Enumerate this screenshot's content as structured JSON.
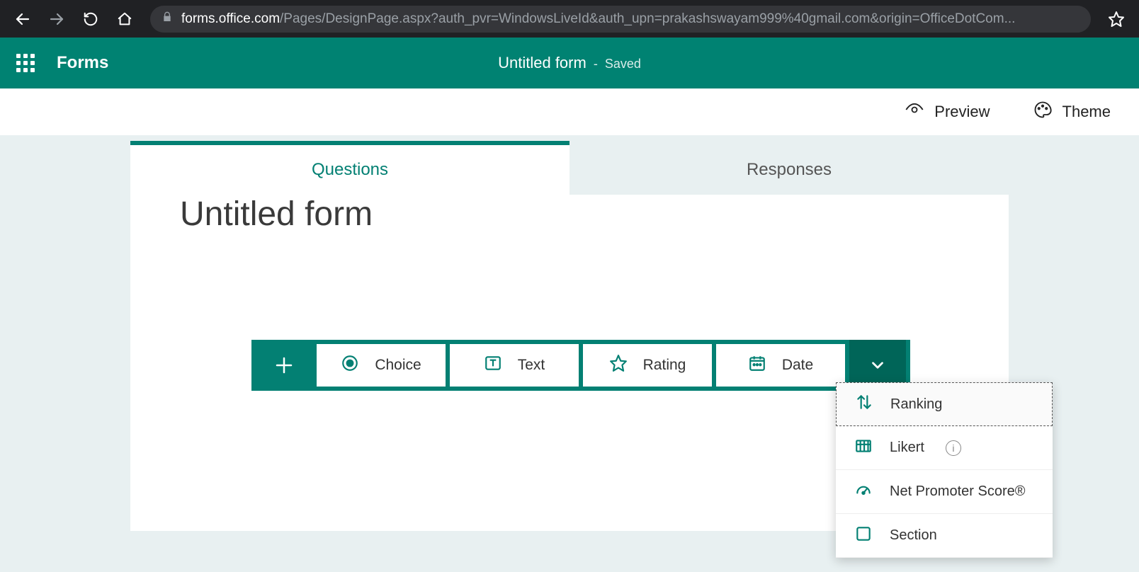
{
  "browser": {
    "url_host": "forms.office.com",
    "url_path": "/Pages/DesignPage.aspx?auth_pvr=WindowsLiveId&auth_upn=prakashswayam999%40gmail.com&origin=OfficeDotCom..."
  },
  "app": {
    "name": "Forms",
    "doc_title": "Untitled form",
    "doc_status_sep": "-",
    "doc_status": "Saved"
  },
  "commands": {
    "preview": "Preview",
    "theme": "Theme"
  },
  "tabs": {
    "questions": "Questions",
    "responses": "Responses"
  },
  "form": {
    "title": "Untitled form"
  },
  "qtypes": {
    "choice": "Choice",
    "text": "Text",
    "rating": "Rating",
    "date": "Date"
  },
  "dropdown": {
    "ranking": "Ranking",
    "likert": "Likert",
    "nps": "Net Promoter Score®",
    "section": "Section"
  }
}
